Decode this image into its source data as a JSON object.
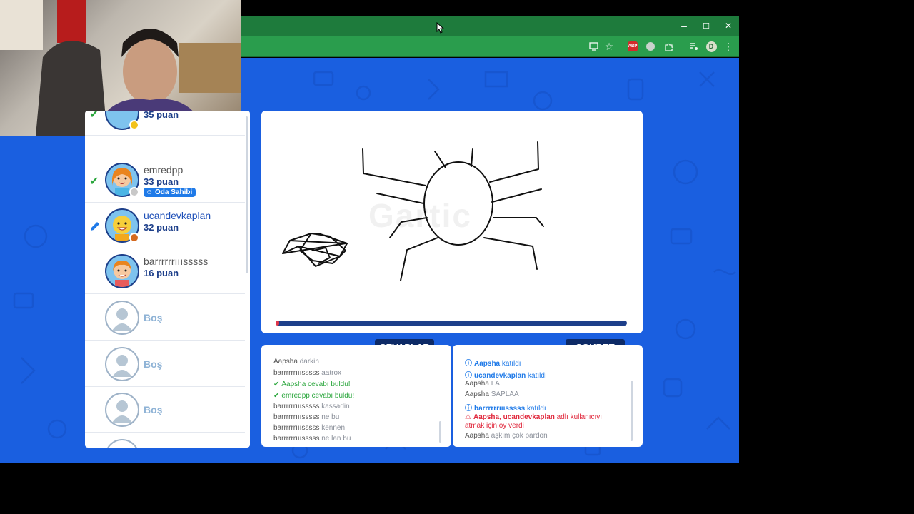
{
  "colors": {
    "accent": "#1a5fe0",
    "titlebar": "#1e7b3c",
    "toolbar": "#2a9d4d",
    "navy": "#1d3f8a",
    "green": "#2aa63c",
    "red": "#e0283c",
    "link": "#1f7ae8"
  },
  "window": {
    "minimize": "–",
    "maximize": "☐",
    "close": "✕"
  },
  "toolbar_icons": [
    "cast-icon",
    "star-icon",
    "abp-icon",
    "extension-icon",
    "puzzle-icon",
    "media-icon",
    "profile-icon",
    "menu-icon"
  ],
  "toolbar": {
    "abp": "ABP",
    "profile": "D",
    "menu": "⋮"
  },
  "players": [
    {
      "name": "",
      "score": "35 puan",
      "dot": "#f2c21b",
      "state": "check"
    },
    {
      "name": "emredpp",
      "score": "33 puan",
      "badge": "Oda Sahibi",
      "dot": "#c8c8c8",
      "state": "check"
    },
    {
      "name": "ucandevkaplan",
      "score": "32 puan",
      "dot": "#d4691e",
      "state": "drawing"
    },
    {
      "name": "barrrrrrııısssss",
      "score": "16 puan",
      "state": ""
    },
    {
      "name": "Boş"
    },
    {
      "name": "Boş"
    },
    {
      "name": "Boş"
    }
  ],
  "canvas": {
    "watermark": "Gartic",
    "progress": 0.01
  },
  "answers": {
    "title": "CEVAPLAR",
    "messages": [
      {
        "user": "Aapsha",
        "text": " darkin",
        "type": "normal"
      },
      {
        "user": "barrrrrrııısssss",
        "text": " aatrox",
        "type": "normal"
      },
      {
        "user": "Aapsha",
        "text": " cevabı buldu!",
        "type": "ok"
      },
      {
        "user": "emredpp",
        "text": " cevabı buldu!",
        "type": "ok"
      },
      {
        "user": "barrrrrrııısssss",
        "text": " kassadin",
        "type": "normal"
      },
      {
        "user": "barrrrrrııısssss",
        "text": " ne bu",
        "type": "normal"
      },
      {
        "user": "barrrrrrııısssss",
        "text": " kennen",
        "type": "normal"
      },
      {
        "user": "barrrrrrııısssss",
        "text": " ne lan bu",
        "type": "normal"
      }
    ]
  },
  "chat": {
    "title": "SOHBET",
    "messages": [
      {
        "user": "Aapsha",
        "text": " katıldı",
        "type": "join"
      },
      {
        "user": "ucandevkaplan",
        "text": " katıldı",
        "type": "join"
      },
      {
        "user": "Aapsha",
        "text": " LA",
        "type": "normal"
      },
      {
        "user": "Aapsha",
        "text": " SAPLAA",
        "type": "normal"
      },
      {
        "user": "barrrrrrııısssss",
        "text": " katıldı",
        "type": "join"
      },
      {
        "user": "Aapsha, ucandevkaplan",
        "text": " adlı kullanıcıyı",
        "text2": "atmak için oy verdi",
        "type": "kick"
      },
      {
        "user": "Aapsha",
        "text": " aşkım çok pardon",
        "type": "normal"
      }
    ]
  }
}
